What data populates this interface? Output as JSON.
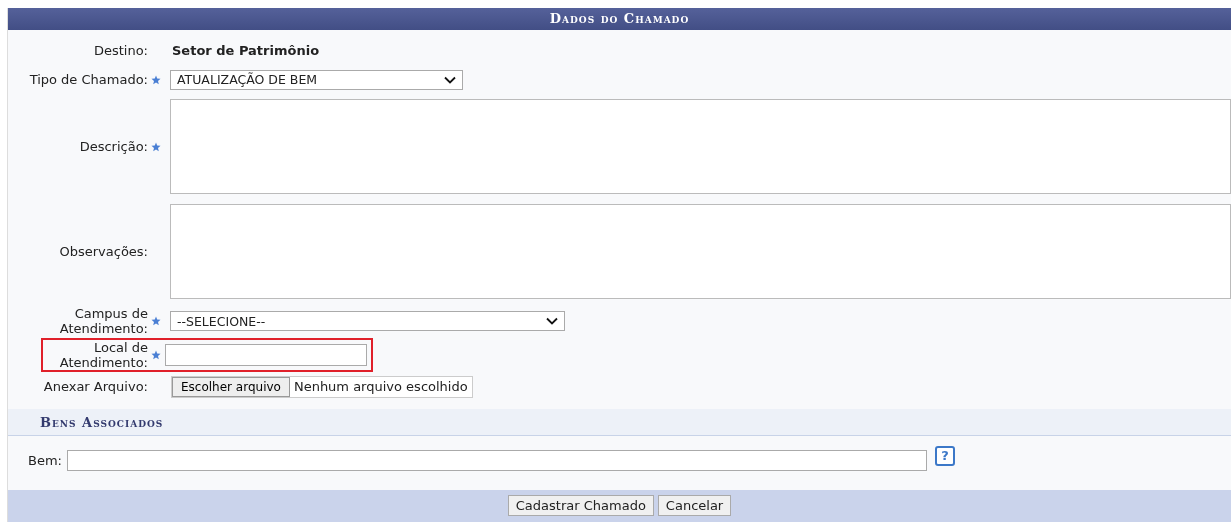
{
  "title": "Dados do Chamado",
  "fields": [
    {
      "kind": "static",
      "label": "Destino:",
      "required": false,
      "value": "Setor de Patrimônio"
    },
    {
      "kind": "select",
      "label": "Tipo de Chamado:",
      "required": true,
      "value": "ATUALIZAÇÃO DE BEM"
    },
    {
      "kind": "textarea",
      "label": "Descrição:",
      "required": true
    },
    {
      "kind": "textarea",
      "label": "Observações:",
      "required": false
    },
    {
      "kind": "select",
      "label": "Campus de Atendimento:",
      "required": true,
      "value": "--SELECIONE--"
    },
    {
      "kind": "input",
      "label": "Local de Atendimento:",
      "required": true,
      "highlighted": true
    },
    {
      "kind": "file",
      "label": "Anexar Arquivo:",
      "required": false,
      "button": "Escolher arquivo",
      "status": "Nenhum arquivo escolhido"
    }
  ],
  "section": {
    "title": "Bens Associados",
    "label": "Bem:",
    "help": "?"
  },
  "buttons": [
    "Cadastrar Chamado",
    "Cancelar"
  ]
}
